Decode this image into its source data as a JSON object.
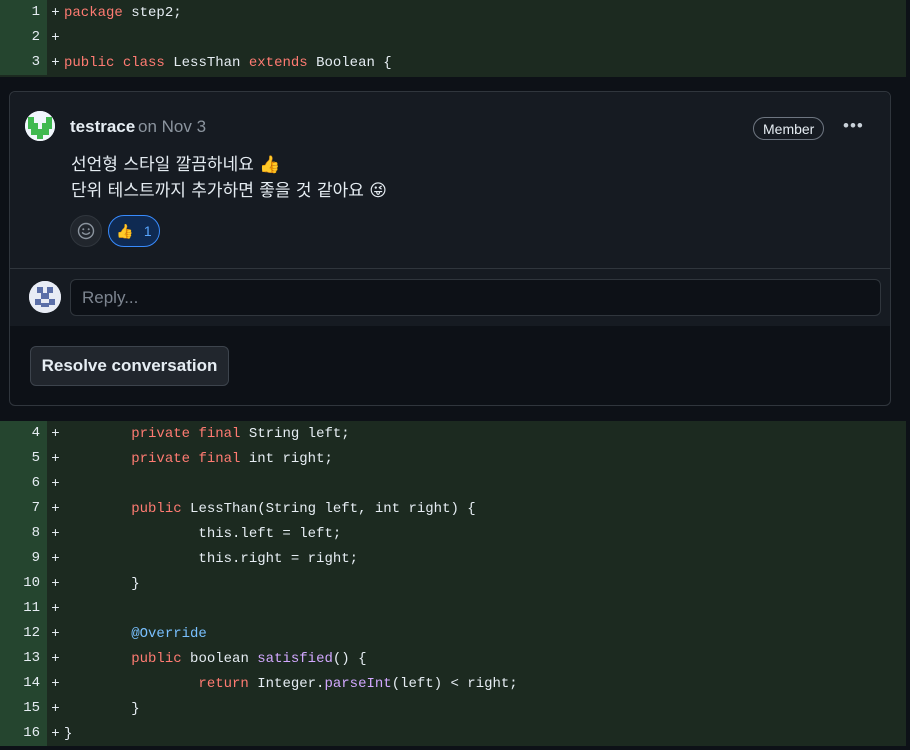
{
  "diff_top": [
    {
      "num": "1",
      "sign": "+",
      "tokens": [
        {
          "t": "package",
          "c": "k"
        },
        {
          "t": " step2;",
          "c": ""
        }
      ]
    },
    {
      "num": "2",
      "sign": "+",
      "tokens": []
    },
    {
      "num": "3",
      "sign": "+",
      "tokens": [
        {
          "t": "public",
          "c": "k"
        },
        {
          "t": " ",
          "c": ""
        },
        {
          "t": "class",
          "c": "k"
        },
        {
          "t": " LessThan ",
          "c": ""
        },
        {
          "t": "extends",
          "c": "k"
        },
        {
          "t": " Boolean {",
          "c": ""
        }
      ]
    }
  ],
  "diff_bottom": [
    {
      "num": "4",
      "sign": "+",
      "tokens": [
        {
          "t": "        ",
          "c": ""
        },
        {
          "t": "private",
          "c": "k"
        },
        {
          "t": " ",
          "c": ""
        },
        {
          "t": "final",
          "c": "k"
        },
        {
          "t": " String left;",
          "c": ""
        }
      ]
    },
    {
      "num": "5",
      "sign": "+",
      "tokens": [
        {
          "t": "        ",
          "c": ""
        },
        {
          "t": "private",
          "c": "k"
        },
        {
          "t": " ",
          "c": ""
        },
        {
          "t": "final",
          "c": "k"
        },
        {
          "t": " int right;",
          "c": ""
        }
      ]
    },
    {
      "num": "6",
      "sign": "+",
      "tokens": []
    },
    {
      "num": "7",
      "sign": "+",
      "tokens": [
        {
          "t": "        ",
          "c": ""
        },
        {
          "t": "public",
          "c": "k"
        },
        {
          "t": " LessThan(String left, int right) {",
          "c": ""
        }
      ]
    },
    {
      "num": "8",
      "sign": "+",
      "tokens": [
        {
          "t": "                this.left = left;",
          "c": ""
        }
      ]
    },
    {
      "num": "9",
      "sign": "+",
      "tokens": [
        {
          "t": "                this.right = right;",
          "c": ""
        }
      ]
    },
    {
      "num": "10",
      "sign": "+",
      "tokens": [
        {
          "t": "        }",
          "c": ""
        }
      ]
    },
    {
      "num": "11",
      "sign": "+",
      "tokens": []
    },
    {
      "num": "12",
      "sign": "+",
      "tokens": [
        {
          "t": "        ",
          "c": ""
        },
        {
          "t": "@Override",
          "c": "an"
        }
      ]
    },
    {
      "num": "13",
      "sign": "+",
      "tokens": [
        {
          "t": "        ",
          "c": ""
        },
        {
          "t": "public",
          "c": "k"
        },
        {
          "t": " boolean ",
          "c": ""
        },
        {
          "t": "satisfied",
          "c": "fn"
        },
        {
          "t": "() {",
          "c": ""
        }
      ]
    },
    {
      "num": "14",
      "sign": "+",
      "tokens": [
        {
          "t": "                ",
          "c": ""
        },
        {
          "t": "return",
          "c": "k"
        },
        {
          "t": " Integer.",
          "c": ""
        },
        {
          "t": "parseInt",
          "c": "fn"
        },
        {
          "t": "(left) < right;",
          "c": ""
        }
      ]
    },
    {
      "num": "15",
      "sign": "+",
      "tokens": [
        {
          "t": "        }",
          "c": ""
        }
      ]
    },
    {
      "num": "16",
      "sign": "+",
      "tokens": [
        {
          "t": "}",
          "c": ""
        }
      ]
    }
  ],
  "comment": {
    "author": "testrace",
    "date": "on Nov 3",
    "badge": "Member",
    "menu_icon": "kebab-horizontal-icon",
    "body_line1": "선언형 스타일 깔끔하네요 👍",
    "body_line2": "단위 테스트까지 추가하면 좋을 것 같아요 😜",
    "reaction_emoji": "👍",
    "reaction_count": "1",
    "add_reaction_icon": "smiley-icon"
  },
  "reply": {
    "placeholder": "Reply..."
  },
  "resolve_label": "Resolve conversation",
  "colors": {
    "added_line_bg": "#1c2a20",
    "added_gutter_bg": "#25452f",
    "keyword": "#ff7b72",
    "function": "#d2a8ff",
    "annotation": "#79c0ff",
    "reaction_accent": "#388bfd"
  }
}
